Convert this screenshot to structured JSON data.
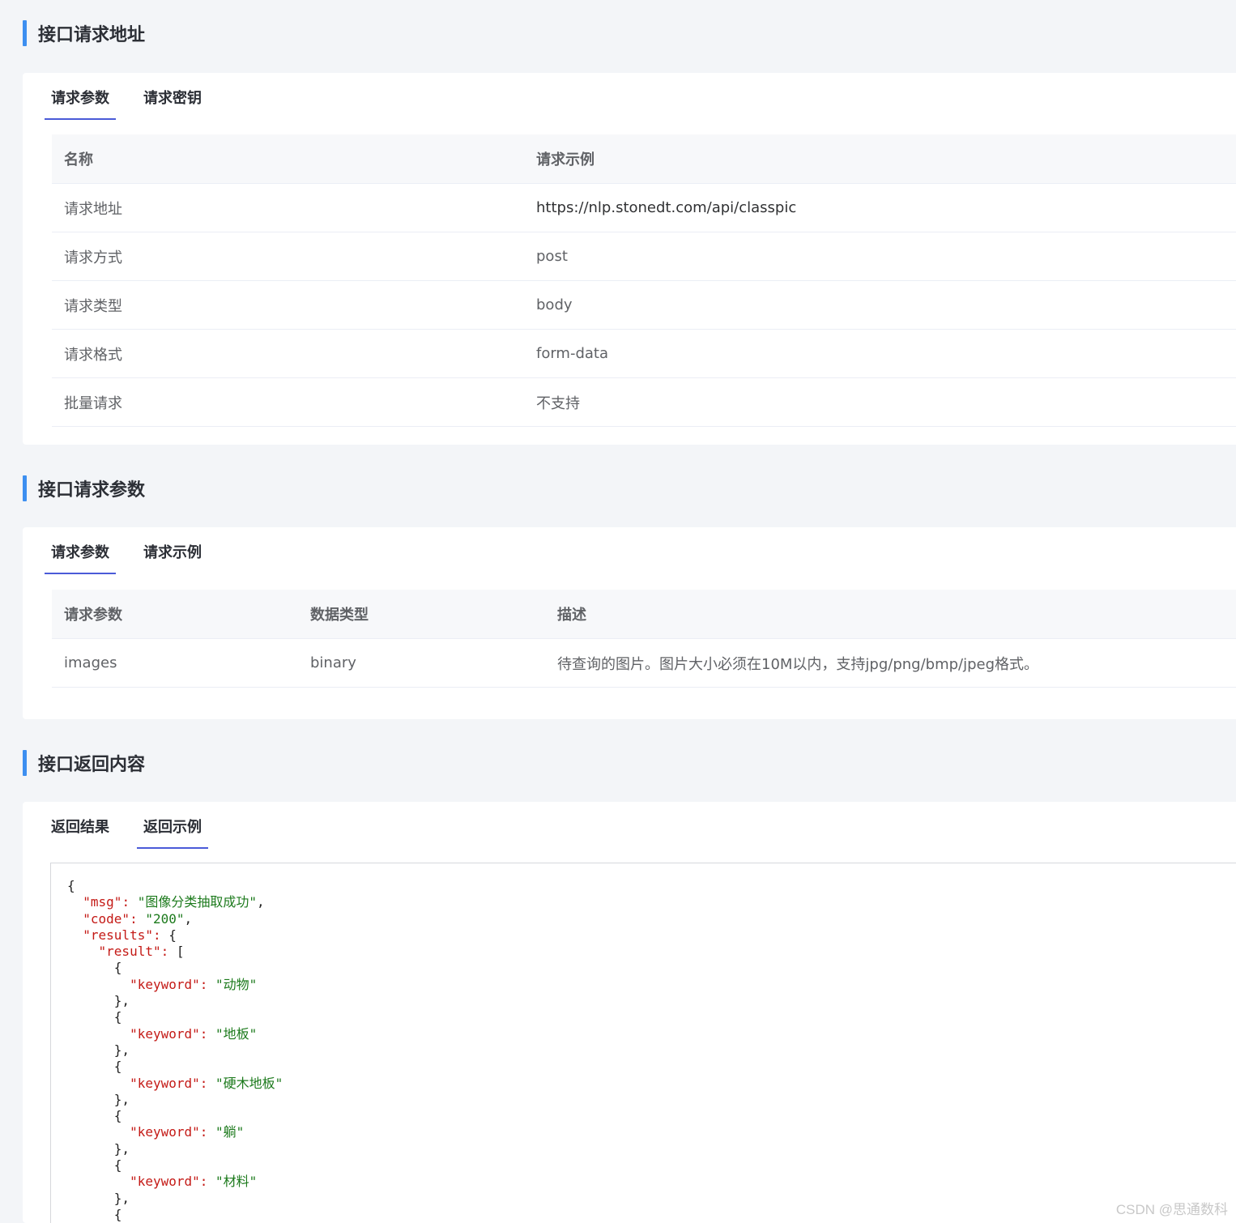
{
  "section1": {
    "title": "接口请求地址",
    "tabs": [
      {
        "label": "请求参数",
        "active": true
      },
      {
        "label": "请求密钥",
        "active": false
      }
    ],
    "headers": [
      "名称",
      "请求示例"
    ],
    "rows": [
      [
        "请求地址",
        "https://nlp.stonedt.com/api/classpic"
      ],
      [
        "请求方式",
        "post"
      ],
      [
        "请求类型",
        "body"
      ],
      [
        "请求格式",
        "form-data"
      ],
      [
        "批量请求",
        "不支持"
      ]
    ]
  },
  "section2": {
    "title": "接口请求参数",
    "tabs": [
      {
        "label": "请求参数",
        "active": true
      },
      {
        "label": "请求示例",
        "active": false
      }
    ],
    "headers": [
      "请求参数",
      "数据类型",
      "描述"
    ],
    "rows": [
      [
        "images",
        "binary",
        "待查询的图片。图片大小必须在10M以内，支持jpg/png/bmp/jpeg格式。"
      ]
    ]
  },
  "section3": {
    "title": "接口返回内容",
    "tabs": [
      {
        "label": "返回结果",
        "active": false
      },
      {
        "label": "返回示例",
        "active": true
      }
    ],
    "code": {
      "msg_key": "\"msg\"",
      "msg_val": "\"图像分类抽取成功\"",
      "code_key": "\"code\"",
      "code_val": "\"200\"",
      "results_key": "\"results\"",
      "result_key": "\"result\"",
      "keyword_key": "\"keyword\"",
      "keywords": [
        "\"动物\"",
        "\"地板\"",
        "\"硬木地板\"",
        "\"躺\"",
        "\"材料\""
      ]
    }
  },
  "watermark": "CSDN @思通数科"
}
